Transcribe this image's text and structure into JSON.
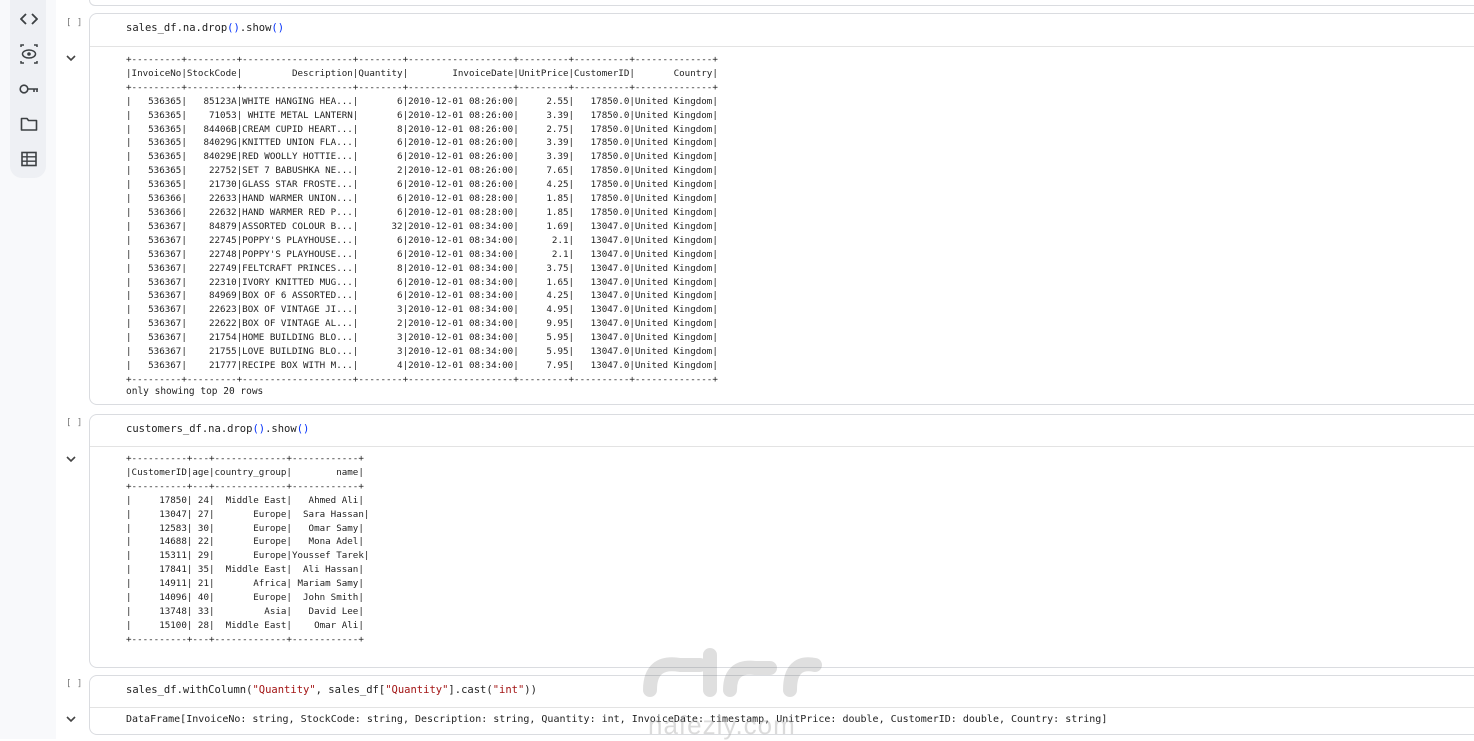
{
  "sidebar": {
    "icons": [
      "code-icon",
      "eye-icon",
      "key-icon",
      "folder-icon",
      "table-icon"
    ]
  },
  "cells": [
    {
      "bracket": "[ ]",
      "code": "sales_df.na.drop().show()",
      "output_lines": [
        "+---------+---------+--------------------+--------+-------------------+---------+----------+--------------+",
        "|InvoiceNo|StockCode|         Description|Quantity|        InvoiceDate|UnitPrice|CustomerID|       Country|",
        "+---------+---------+--------------------+--------+-------------------+---------+----------+--------------+",
        "|   536365|   85123A|WHITE HANGING HEA...|       6|2010-12-01 08:26:00|     2.55|   17850.0|United Kingdom|",
        "|   536365|    71053| WHITE METAL LANTERN|       6|2010-12-01 08:26:00|     3.39|   17850.0|United Kingdom|",
        "|   536365|   84406B|CREAM CUPID HEART...|       8|2010-12-01 08:26:00|     2.75|   17850.0|United Kingdom|",
        "|   536365|   84029G|KNITTED UNION FLA...|       6|2010-12-01 08:26:00|     3.39|   17850.0|United Kingdom|",
        "|   536365|   84029E|RED WOOLLY HOTTIE...|       6|2010-12-01 08:26:00|     3.39|   17850.0|United Kingdom|",
        "|   536365|    22752|SET 7 BABUSHKA NE...|       2|2010-12-01 08:26:00|     7.65|   17850.0|United Kingdom|",
        "|   536365|    21730|GLASS STAR FROSTE...|       6|2010-12-01 08:26:00|     4.25|   17850.0|United Kingdom|",
        "|   536366|    22633|HAND WARMER UNION...|       6|2010-12-01 08:28:00|     1.85|   17850.0|United Kingdom|",
        "|   536366|    22632|HAND WARMER RED P...|       6|2010-12-01 08:28:00|     1.85|   17850.0|United Kingdom|",
        "|   536367|    84879|ASSORTED COLOUR B...|      32|2010-12-01 08:34:00|     1.69|   13047.0|United Kingdom|",
        "|   536367|    22745|POPPY'S PLAYHOUSE...|       6|2010-12-01 08:34:00|      2.1|   13047.0|United Kingdom|",
        "|   536367|    22748|POPPY'S PLAYHOUSE...|       6|2010-12-01 08:34:00|      2.1|   13047.0|United Kingdom|",
        "|   536367|    22749|FELTCRAFT PRINCES...|       8|2010-12-01 08:34:00|     3.75|   13047.0|United Kingdom|",
        "|   536367|    22310|IVORY KNITTED MUG...|       6|2010-12-01 08:34:00|     1.65|   13047.0|United Kingdom|",
        "|   536367|    84969|BOX OF 6 ASSORTED...|       6|2010-12-01 08:34:00|     4.25|   13047.0|United Kingdom|",
        "|   536367|    22623|BOX OF VINTAGE JI...|       3|2010-12-01 08:34:00|     4.95|   13047.0|United Kingdom|",
        "|   536367|    22622|BOX OF VINTAGE AL...|       2|2010-12-01 08:34:00|     9.95|   13047.0|United Kingdom|",
        "|   536367|    21754|HOME BUILDING BLO...|       3|2010-12-01 08:34:00|     5.95|   13047.0|United Kingdom|",
        "|   536367|    21755|LOVE BUILDING BLO...|       3|2010-12-01 08:34:00|     5.95|   13047.0|United Kingdom|",
        "|   536367|    21777|RECIPE BOX WITH M...|       4|2010-12-01 08:34:00|     7.95|   13047.0|United Kingdom|",
        "+---------+---------+--------------------+--------+-------------------+---------+----------+--------------+"
      ],
      "note": "only showing top 20 rows"
    },
    {
      "bracket": "[ ]",
      "code": "customers_df.na.drop().show()",
      "output_lines": [
        "+----------+---+-------------+------------+",
        "|CustomerID|age|country_group|        name|",
        "+----------+---+-------------+------------+",
        "|     17850| 24|  Middle East|   Ahmed Ali|",
        "|     13047| 27|       Europe|  Sara Hassan|",
        "|     12583| 30|       Europe|   Omar Samy|",
        "|     14688| 22|       Europe|   Mona Adel|",
        "|     15311| 29|       Europe|Youssef Tarek|",
        "|     17841| 35|  Middle East|  Ali Hassan|",
        "|     14911| 21|       Africa| Mariam Samy|",
        "|     14096| 40|       Europe|  John Smith|",
        "|     13748| 33|         Asia|   David Lee|",
        "|     15100| 28|  Middle East|    Omar Ali|",
        "+----------+---+-------------+------------+"
      ]
    },
    {
      "bracket": "[ ]",
      "code_parts": [
        "sales_df.withColumn(",
        "\"Quantity\"",
        ", sales_df[",
        "\"Quantity\"",
        "].cast(",
        "\"int\"",
        "))"
      ],
      "output": "DataFrame[InvoiceNo: string, StockCode: string, Description: string, Quantity: int, InvoiceDate: timestamp, UnitPrice: double, CustomerID: double, Country: string]"
    }
  ],
  "watermark": {
    "text": "nafezly.com"
  }
}
